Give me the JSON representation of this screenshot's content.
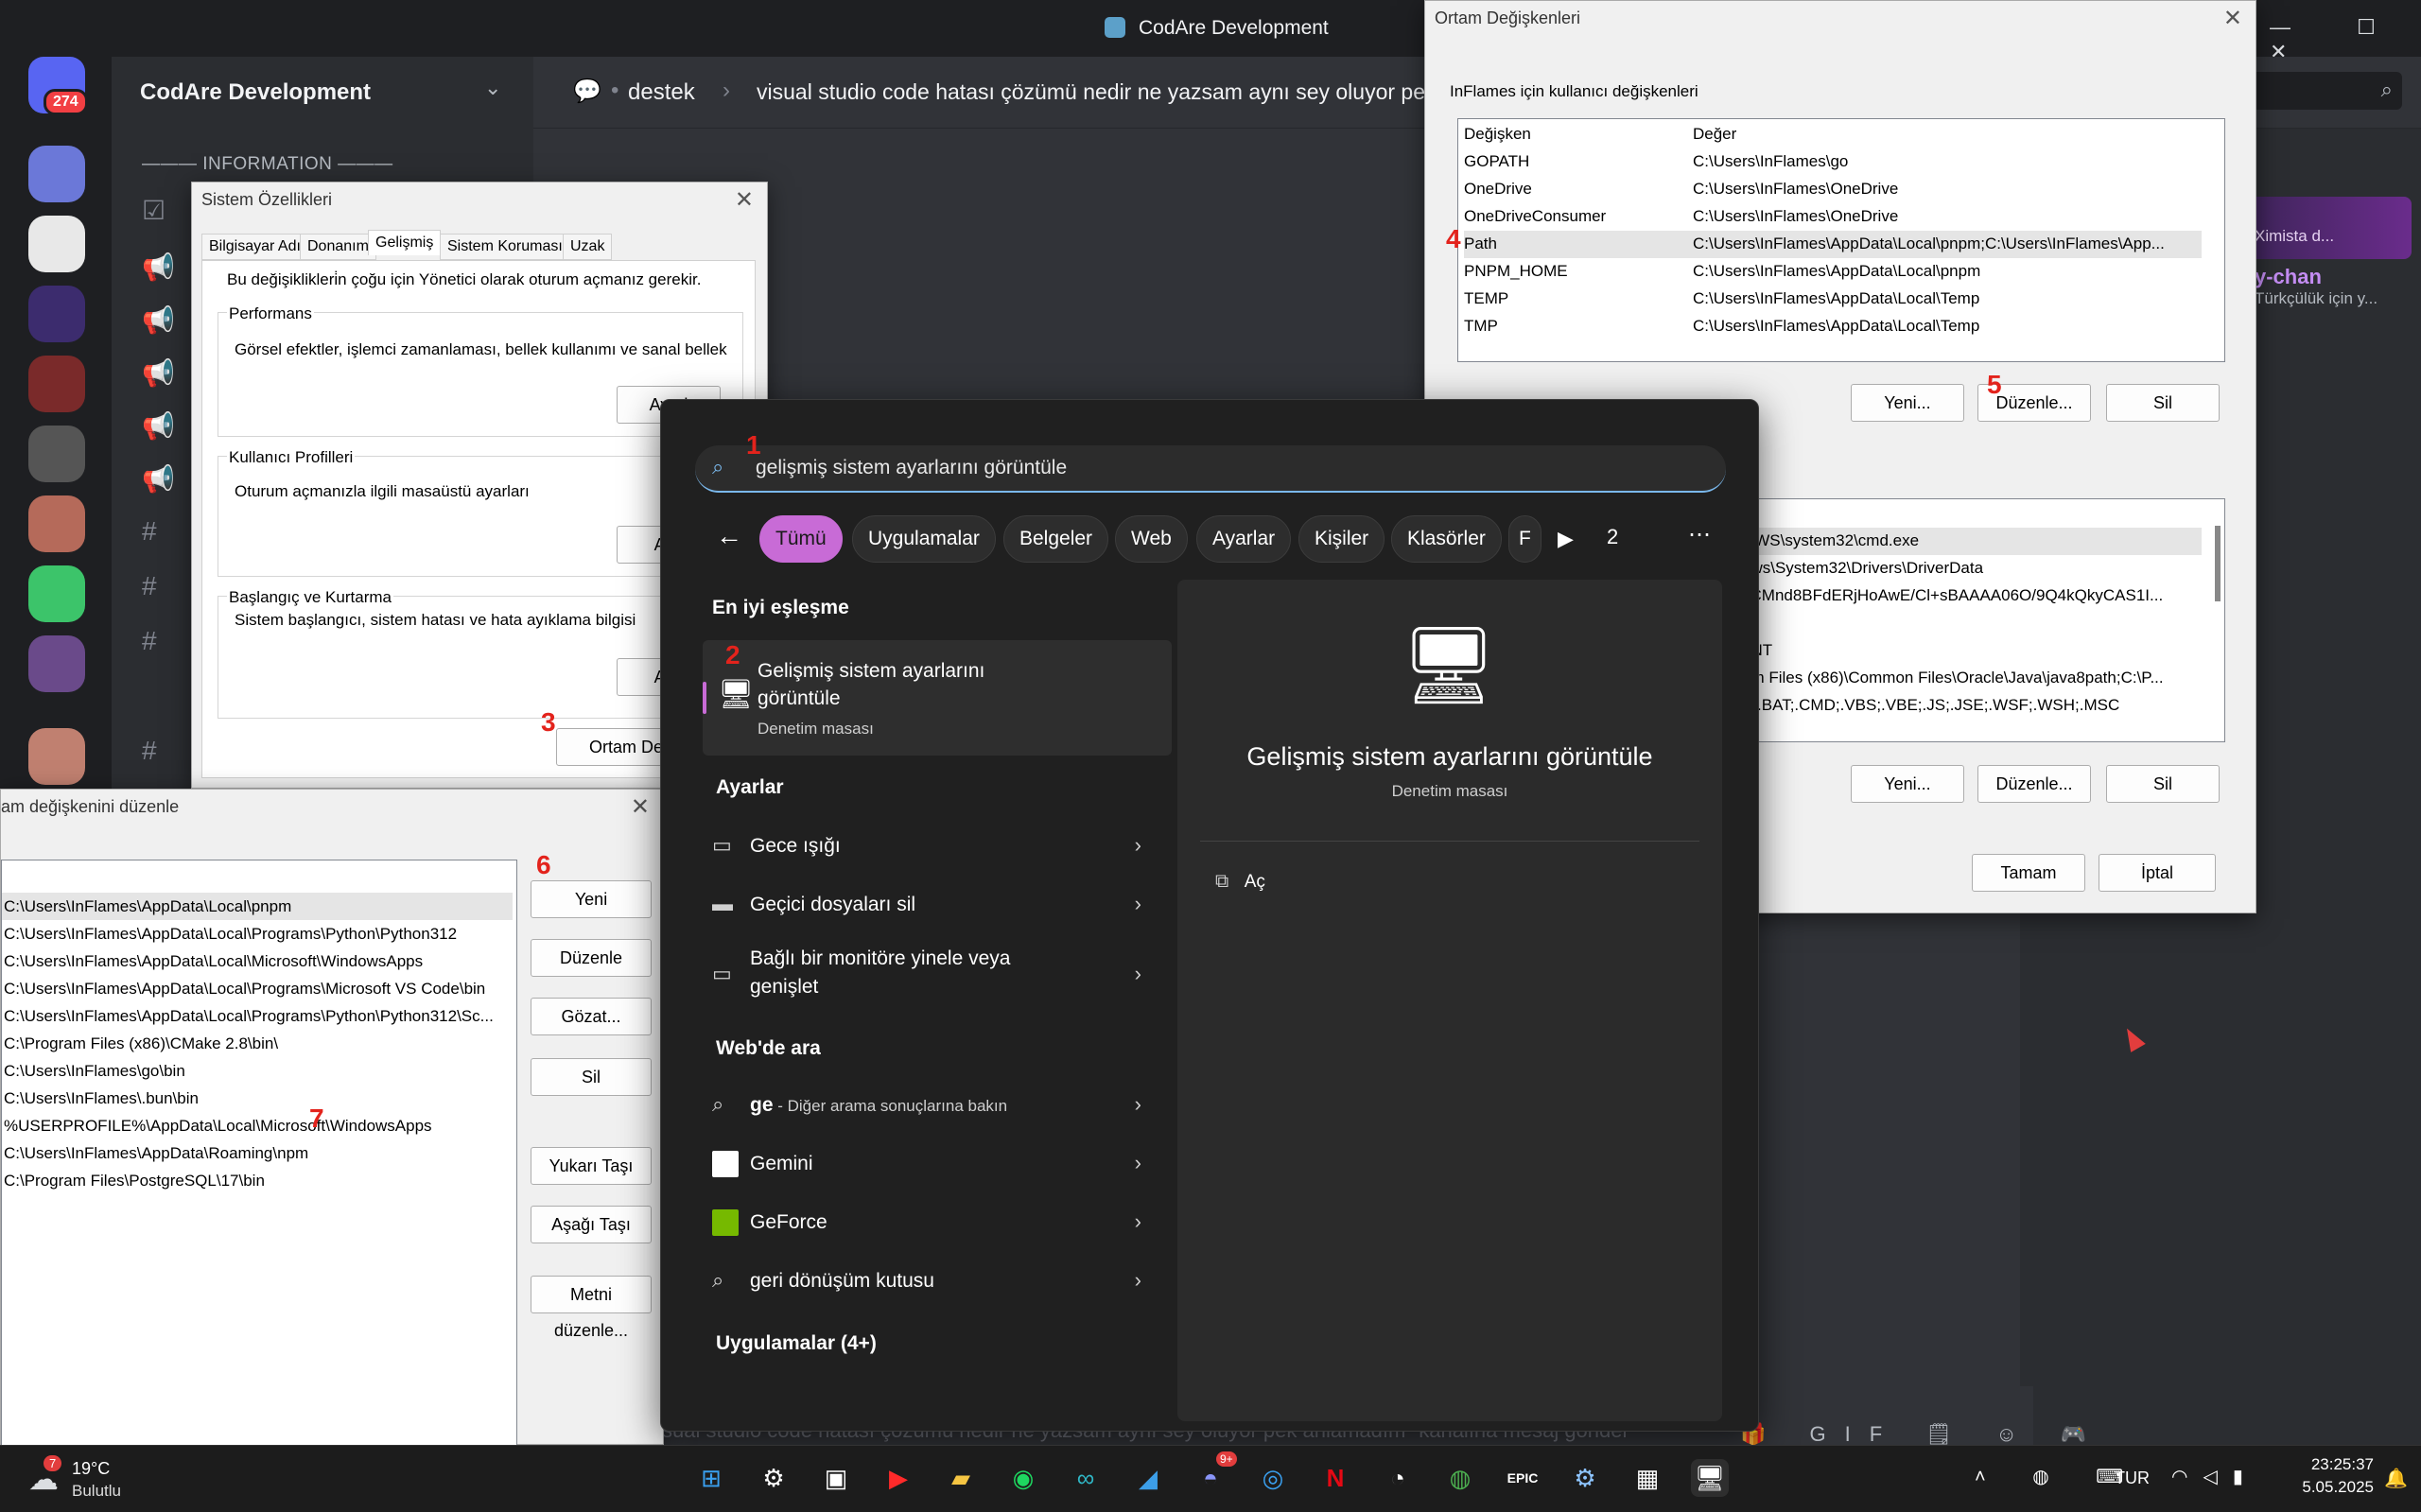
{
  "discord": {
    "window_title": "CodAre Development",
    "server_name": "CodAre Development",
    "notif_count": "274",
    "category": "——— INFORMATION ———",
    "header_dot": "•",
    "header_channel": "destek",
    "header_sep": "›",
    "header_thread": "visual studio code hatası çözümü nedir ne yazsam aynı sey oluyor pek",
    "member_card": "Ximista d...",
    "member_name": "y-chan",
    "member_sub": "Türkçülük için y...",
    "input_placeholder": "sual studio code hatası çözümü nedir ne yazsam aynı sey oluyor pek anlamadım\" kanalına mesaj gönder",
    "window_controls": "— ☐ ✕"
  },
  "system_properties": {
    "title": "Sistem Özellikleri",
    "tabs": [
      "Bilgisayar Adı",
      "Donanım",
      "Gelişmiş",
      "Sistem Koruması",
      "Uzak"
    ],
    "selected_tab": "Gelişmiş",
    "admin_note": "Bu değişiklikleri̇n çoğu için Yönetici olarak oturum açmanız gerekir.",
    "groups": [
      {
        "title": "Performans",
        "desc": "Görsel efektler, işlemci zamanlaması, bellek kullanımı ve sanal bellek",
        "button": "Ayarl"
      },
      {
        "title": "Kullanıcı Profilleri",
        "desc": "Oturum açmanızla ilgili masaüstü ayarları",
        "button": "Aya"
      },
      {
        "title": "Başlangıç ve Kurtarma",
        "desc": "Sistem başlangıcı, sistem hatası ve hata ayıklama bilgisi",
        "button": "Aya"
      }
    ],
    "env_button": "Ortam Değişk",
    "marker": "3"
  },
  "env_vars": {
    "title": "Ortam Değişkenleri",
    "user_section": "InFlames için kullanıcı değişkenleri",
    "col_var": "Değişken",
    "col_val": "Değer",
    "user_rows": [
      {
        "name": "GOPATH",
        "value": "C:\\Users\\InFlames\\go"
      },
      {
        "name": "OneDrive",
        "value": "C:\\Users\\InFlames\\OneDrive"
      },
      {
        "name": "OneDriveConsumer",
        "value": "C:\\Users\\InFlames\\OneDrive"
      },
      {
        "name": "Path",
        "value": "C:\\Users\\InFlames\\AppData\\Local\\pnpm;C:\\Users\\InFlames\\App..."
      },
      {
        "name": "PNPM_HOME",
        "value": "C:\\Users\\InFlames\\AppData\\Local\\pnpm"
      },
      {
        "name": "TEMP",
        "value": "C:\\Users\\InFlames\\AppData\\Local\\Temp"
      },
      {
        "name": "TMP",
        "value": "C:\\Users\\InFlames\\AppData\\Local\\Temp"
      }
    ],
    "user_buttons": {
      "new": "Yeni...",
      "edit": "Düzenle...",
      "delete": "Sil"
    },
    "system_rows": [
      "OWS\\system32\\cmd.exe",
      "ows\\System32\\Drivers\\DriverData",
      "JCMnd8BFdERjHoAwE/Cl+sBAAAA06O/9Q4kQkyCAS1I...",
      "",
      "_NT",
      "am Files (x86)\\Common Files\\Oracle\\Java\\java8path;C:\\P...",
      "E;.BAT;.CMD;.VBS;.VBE;.JS;.JSE;.WSF;.WSH;.MSC"
    ],
    "system_buttons": {
      "new": "Yeni...",
      "edit": "Düzenle...",
      "delete": "Sil"
    },
    "ok": "Tamam",
    "cancel": "İptal",
    "marker_path": "4",
    "marker_edit": "5"
  },
  "edit_env": {
    "title": "am değişkenini düzenle",
    "rows": [
      "C:\\Users\\InFlames\\AppData\\Local\\pnpm",
      "C:\\Users\\InFlames\\AppData\\Local\\Programs\\Python\\Python312",
      "C:\\Users\\InFlames\\AppData\\Local\\Microsoft\\WindowsApps",
      "C:\\Users\\InFlames\\AppData\\Local\\Programs\\Microsoft VS Code\\bin",
      "C:\\Users\\InFlames\\AppData\\Local\\Programs\\Python\\Python312\\Sc...",
      "C:\\Program Files (x86)\\CMake 2.8\\bin\\",
      "C:\\Users\\InFlames\\go\\bin",
      "C:\\Users\\InFlames\\.bun\\bin",
      "%USERPROFILE%\\AppData\\Local\\Microsoft\\WindowsApps",
      "C:\\Users\\InFlames\\AppData\\Roaming\\npm",
      "C:\\Program Files\\PostgreSQL\\17\\bin"
    ],
    "buttons": {
      "new": "Yeni",
      "edit": "Düzenle",
      "browse": "Gözat...",
      "delete": "Sil",
      "up": "Yukarı Taşı",
      "down": "Aşağı Taşı",
      "text": "Metni düzenle..."
    },
    "marker_new": "6",
    "marker_npm": "7"
  },
  "start_menu": {
    "search_text": "gelişmiş sistem ayarlarını görüntüle",
    "marker_search": "1",
    "filters": [
      "Tümü",
      "Uygulamalar",
      "Belgeler",
      "Web",
      "Ayarlar",
      "Kişiler",
      "Klasörler",
      "F"
    ],
    "filter_count": "2",
    "best_match_header": "En iyi eşleşme",
    "best_match_title": "Gelişmiş sistem ayarlarını görüntüle",
    "best_match_sub": "Denetim masası",
    "marker_best": "2",
    "settings_header": "Ayarlar",
    "settings_items": [
      "Gece ışığı",
      "Geçici dosyaları sil",
      "Bağlı bir monitöre yinele veya genişlet"
    ],
    "web_header": "Web'de ara",
    "web_items": [
      {
        "bold": "ge",
        "rest": " - Diğer arama sonuçlarına bakın"
      },
      {
        "bold": "Gemini",
        "rest": ""
      },
      {
        "bold": "GeForce",
        "rest": ""
      },
      {
        "bold": "geri dönüşüm kutusu",
        "rest": ""
      }
    ],
    "apps_header": "Uygulamalar (4+)",
    "detail_title": "Gelişmiş sistem ayarlarını görüntüle",
    "detail_sub": "Denetim masası",
    "detail_action": "Aç"
  },
  "taskbar": {
    "weather_temp": "19°C",
    "weather_desc": "Bulutlu",
    "weather_badge": "7",
    "lang": "TUR",
    "time": "23:25:37",
    "date": "5.05.2025",
    "discord_badge": "9+"
  },
  "colors": {
    "accent": "#c86bd6",
    "marker_red": "#e3231c",
    "discord_bg": "#313338"
  }
}
